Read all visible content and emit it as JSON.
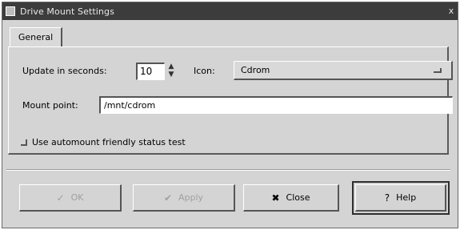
{
  "window": {
    "title": "Drive Mount Settings",
    "close_glyph": "x"
  },
  "tabs": [
    {
      "label": "General"
    }
  ],
  "general": {
    "update_label": "Update in seconds:",
    "update_value": "10",
    "spin_up_glyph": "▲",
    "spin_down_glyph": "▼",
    "icon_label": "Icon:",
    "icon_value": "Cdrom",
    "mount_label": "Mount point:",
    "mount_value": "/mnt/cdrom",
    "automount_label": "Use automount friendly status test",
    "automount_checked": false
  },
  "buttons": {
    "ok": {
      "label": "OK",
      "icon": "ok-icon",
      "glyph": "✓",
      "disabled": true
    },
    "apply": {
      "label": "Apply",
      "icon": "checkmark-icon",
      "glyph": "✔",
      "disabled": true
    },
    "close": {
      "label": "Close",
      "icon": "close-icon",
      "glyph": "✖",
      "disabled": false
    },
    "help": {
      "label": "Help",
      "icon": "help-icon",
      "glyph": "?",
      "disabled": false
    }
  },
  "colors": {
    "titlebar": "#3c3c3c",
    "window_bg": "#d4d4d4",
    "field_bg": "#ffffff",
    "disabled_text": "#a0a0a0"
  }
}
